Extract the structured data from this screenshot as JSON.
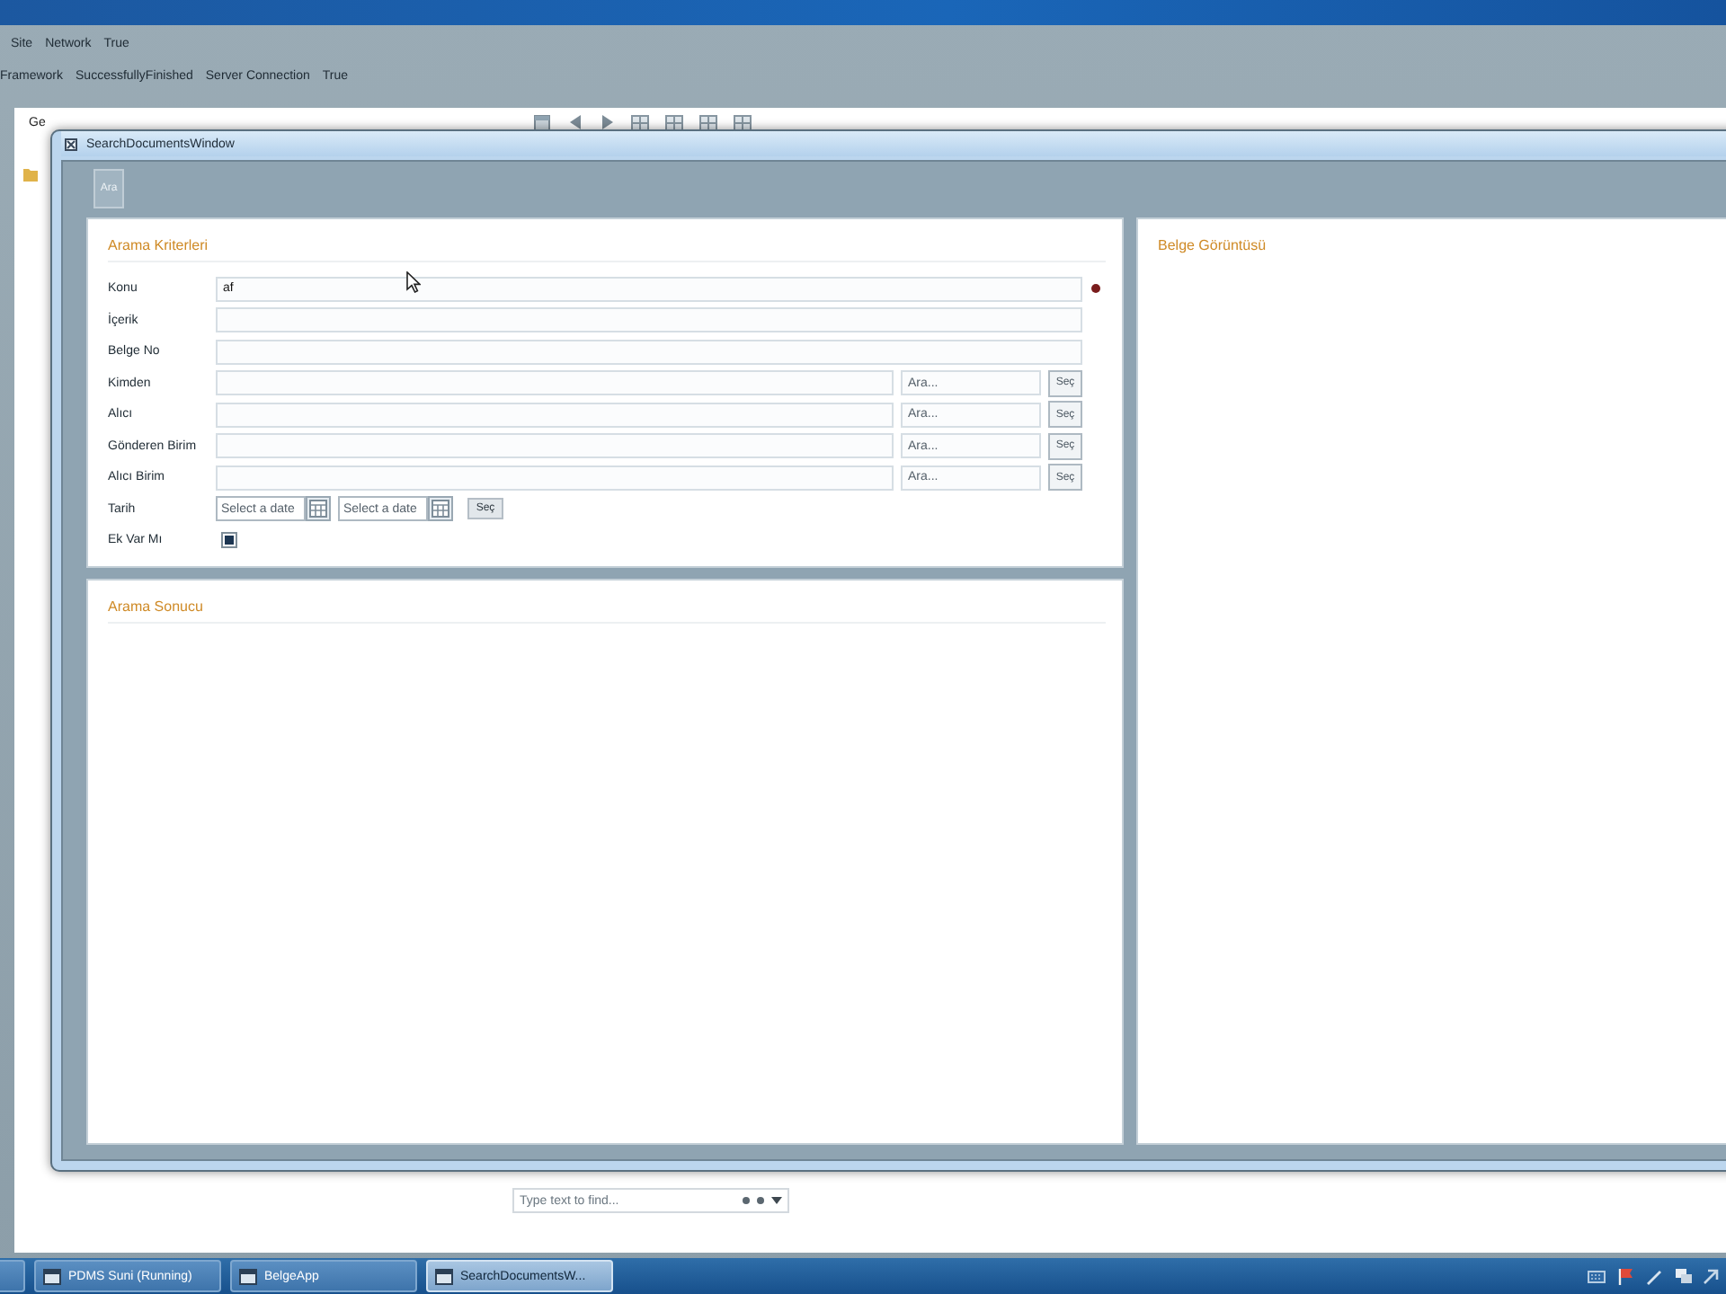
{
  "status_lines": [
    {
      "items": [
        "Site",
        "Network",
        "True"
      ]
    },
    {
      "items": [
        "Framework",
        "SuccessfullyFinished",
        "Server Connection",
        "True"
      ]
    }
  ],
  "back_window": {
    "title": "Ge",
    "find_field": {
      "placeholder": "Type text to find..."
    }
  },
  "window": {
    "title": "SearchDocumentsWindow",
    "toolbar": [
      {
        "label": "Ara"
      }
    ],
    "criteria_panel": {
      "title": "Arama Kriterleri",
      "fields": [
        {
          "kind": "text",
          "label": "Konu",
          "value": "af",
          "required": true
        },
        {
          "kind": "text",
          "label": "İçerik",
          "required": false
        },
        {
          "kind": "text",
          "label": "Belge No",
          "required": false
        },
        {
          "kind": "lookup",
          "label": "Kimden",
          "placeholder": "Ara...",
          "button": "Seç"
        },
        {
          "kind": "lookup",
          "label": "Alıcı",
          "placeholder": "Ara...",
          "button": "Seç"
        },
        {
          "kind": "lookup",
          "label": "Gönderen Birim",
          "placeholder": "Ara...",
          "button": "Seç"
        },
        {
          "kind": "lookup",
          "label": "Alıcı Birim",
          "placeholder": "Ara...",
          "button": "Seç"
        },
        {
          "kind": "date_range",
          "label": "Tarih",
          "from_placeholder": "Select a date",
          "to_placeholder": "Select a date",
          "button": "Seç"
        },
        {
          "kind": "checkbox",
          "label": "Ek Var Mı",
          "checked": true
        }
      ]
    },
    "results_panel": {
      "title": "Arama Sonucu"
    },
    "preview_panel": {
      "title": "Belge Görüntüsü"
    }
  },
  "taskbar": {
    "buttons": [
      {
        "label": "PDMS Suni (Running)",
        "selected": false
      },
      {
        "label": "BelgeApp",
        "selected": false
      },
      {
        "label": "SearchDocumentsW...",
        "selected": true
      }
    ]
  }
}
